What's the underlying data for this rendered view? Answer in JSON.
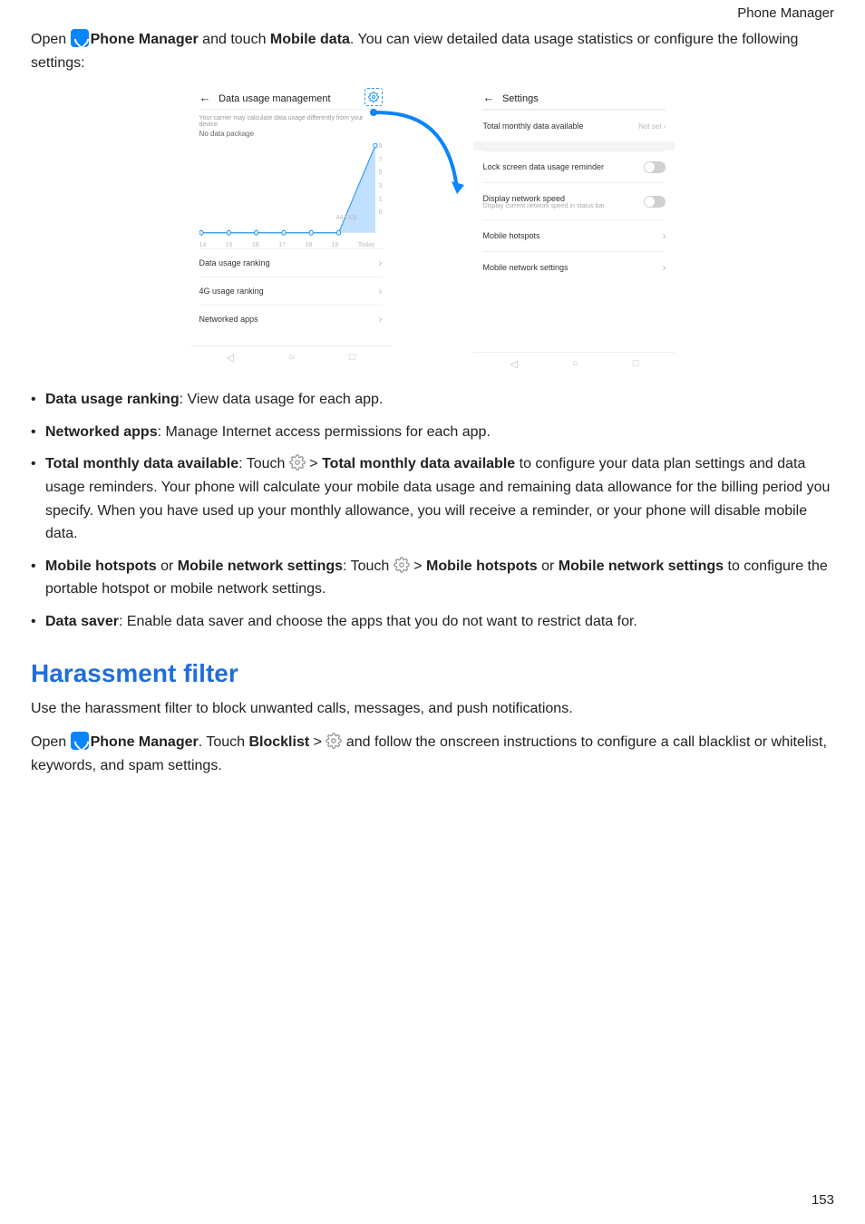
{
  "header": {
    "section_name": "Phone Manager"
  },
  "intro": {
    "open": "Open ",
    "app_name": "Phone Manager",
    "mid": " and touch ",
    "mobile_data": "Mobile data",
    "after": ". You can view detailed data usage statistics or configure the following settings:"
  },
  "screenshot_left": {
    "title": "Data usage management",
    "note_line1": "Your carrier may calculate data usage differently from your device.",
    "note_line2": "No data package",
    "chart_label": "443 KB",
    "rows": {
      "rank": "Data usage ranking",
      "g4": "4G usage ranking",
      "net": "Networked apps"
    }
  },
  "screenshot_right": {
    "title": "Settings",
    "row1": "Total monthly data available",
    "row1_val": "Not set",
    "row2": "Lock screen data usage reminder",
    "row3": "Display network speed",
    "row3_desc": "Display current network speed in status bar",
    "row4": "Mobile hotspots",
    "row5": "Mobile network settings"
  },
  "chart_data": {
    "type": "area",
    "x": [
      "14",
      "15",
      "16",
      "17",
      "18",
      "19",
      "Today"
    ],
    "values": [
      0,
      0,
      0,
      0,
      0,
      0,
      443
    ],
    "ylabel_ticks": [
      "9",
      "7",
      "5",
      "3",
      "1",
      "0"
    ],
    "data_label": "443 KB"
  },
  "bullets": {
    "b1_title": "Data usage ranking",
    "b1_rest": ": View data usage for each app.",
    "b2_title": "Networked apps",
    "b2_rest": ": Manage Internet access permissions for each app.",
    "b3_title": "Total monthly data available",
    "b3_mid1": ": Touch ",
    "b3_gt": " > ",
    "b3_title2": "Total monthly data available",
    "b3_rest": " to configure your data plan settings and data usage reminders. Your phone will calculate your mobile data usage and remaining data allowance for the billing period you specify. When you have used up your monthly allowance, you will receive a reminder, or your phone will disable mobile data.",
    "b4_title": "Mobile hotspots",
    "b4_or": " or ",
    "b4_title2": "Mobile network settings",
    "b4_mid": ": Touch ",
    "b4_gt": " > ",
    "b4_title3": "Mobile hotspots",
    "b4_title4": "Mobile network settings",
    "b4_rest": " to configure the portable hotspot or mobile network settings.",
    "b5_title": "Data saver",
    "b5_rest": ": Enable data saver and choose the apps that you do not want to restrict data for."
  },
  "section2": {
    "heading": "Harassment filter",
    "p1": "Use the harassment filter to block unwanted calls, messages, and push notifications.",
    "open": "Open ",
    "app_name": "Phone Manager",
    "touch": ". Touch ",
    "blocklist": "Blocklist",
    "gt": " > ",
    "rest": " and follow the onscreen instructions to configure a call blacklist or whitelist, keywords, and spam settings."
  },
  "page_number": "153"
}
